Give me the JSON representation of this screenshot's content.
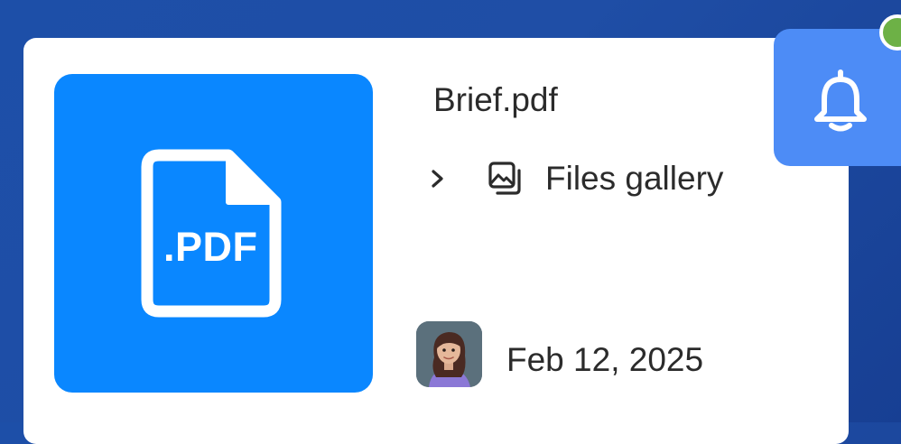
{
  "file": {
    "name": "Brief.pdf",
    "type_label": ".PDF",
    "icon": "pdf-file-icon",
    "thumbnail_color": "#0a87ff"
  },
  "breadcrumb": {
    "chevron_icon": "chevron-right-icon",
    "folder_icon": "image-gallery-icon",
    "label": "Files gallery"
  },
  "meta": {
    "date": "Feb 12, 2025",
    "owner_avatar": "user-avatar"
  },
  "notifications": {
    "icon": "bell-icon",
    "button_color": "#4d8cf6",
    "status_color": "#6db146"
  }
}
